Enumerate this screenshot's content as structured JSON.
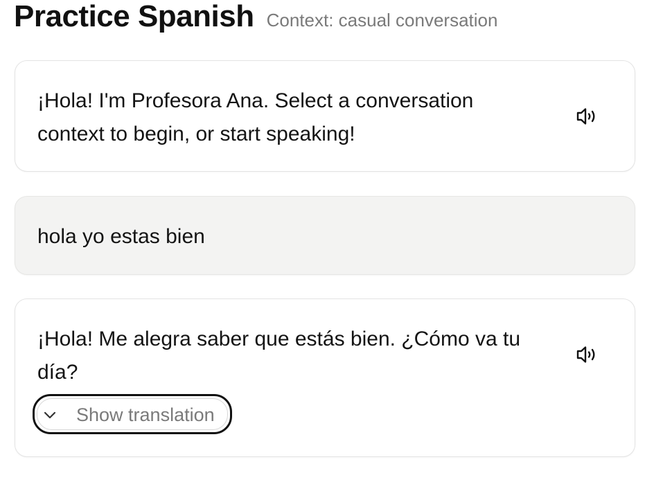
{
  "header": {
    "title": "Practice Spanish",
    "context": "Context: casual conversation"
  },
  "messages": [
    {
      "role": "assistant",
      "line1": "¡Hola! I'm Profesora Ana. Select a conversation",
      "line2": "context to begin, or start speaking!",
      "speaker_icon": "speaker-icon"
    },
    {
      "role": "user",
      "line1": "hola yo estas bien"
    },
    {
      "role": "assistant",
      "line1": "¡Hola! Me alegra saber que estás bien. ¿Cómo va tu",
      "line2": "día?",
      "speaker_icon": "speaker-icon",
      "translation_toggle": {
        "label": "Show translation",
        "icon": "chevron-down-icon"
      }
    }
  ]
}
